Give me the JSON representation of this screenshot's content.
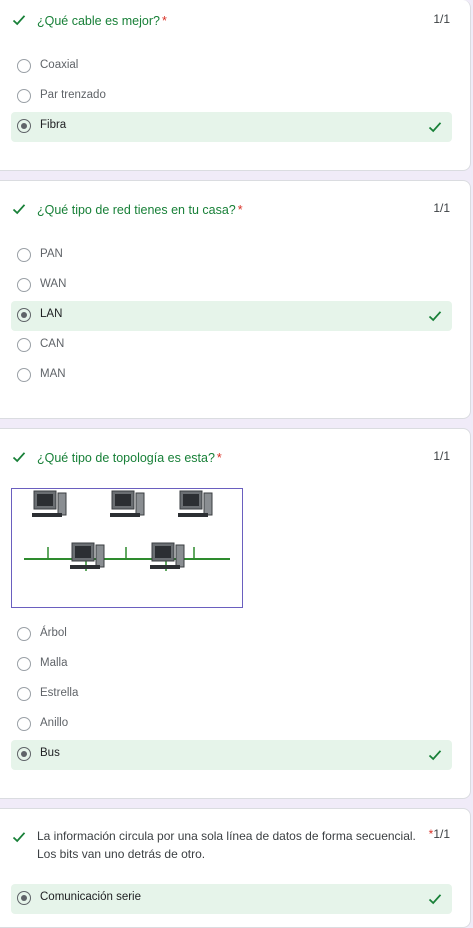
{
  "questions": [
    {
      "title": "¿Qué cable es mejor?",
      "required": "*",
      "score": "1/1",
      "options": [
        "Coaxial",
        "Par trenzado",
        "Fibra"
      ]
    },
    {
      "title": "¿Qué tipo de red tienes en tu casa?",
      "required": "*",
      "score": "1/1",
      "options": [
        "PAN",
        "WAN",
        "LAN",
        "CAN",
        "MAN"
      ]
    },
    {
      "title": "¿Qué tipo de topología es esta?",
      "required": "*",
      "score": "1/1",
      "options": [
        "Árbol",
        "Malla",
        "Estrella",
        "Anillo",
        "Bus"
      ]
    },
    {
      "title": "La información circula por una sola línea de datos de forma secuencial. Los bits van uno detrás de otro.",
      "required": "*",
      "score": "1/1",
      "options": [
        "Comunicación serie"
      ]
    }
  ],
  "colors": {
    "correct": "#188038",
    "correct_bg": "#e6f4ea",
    "required": "#d93025",
    "background": "#f0ebf8"
  },
  "icons": {
    "check": "check-icon",
    "radio": "radio-icon"
  }
}
